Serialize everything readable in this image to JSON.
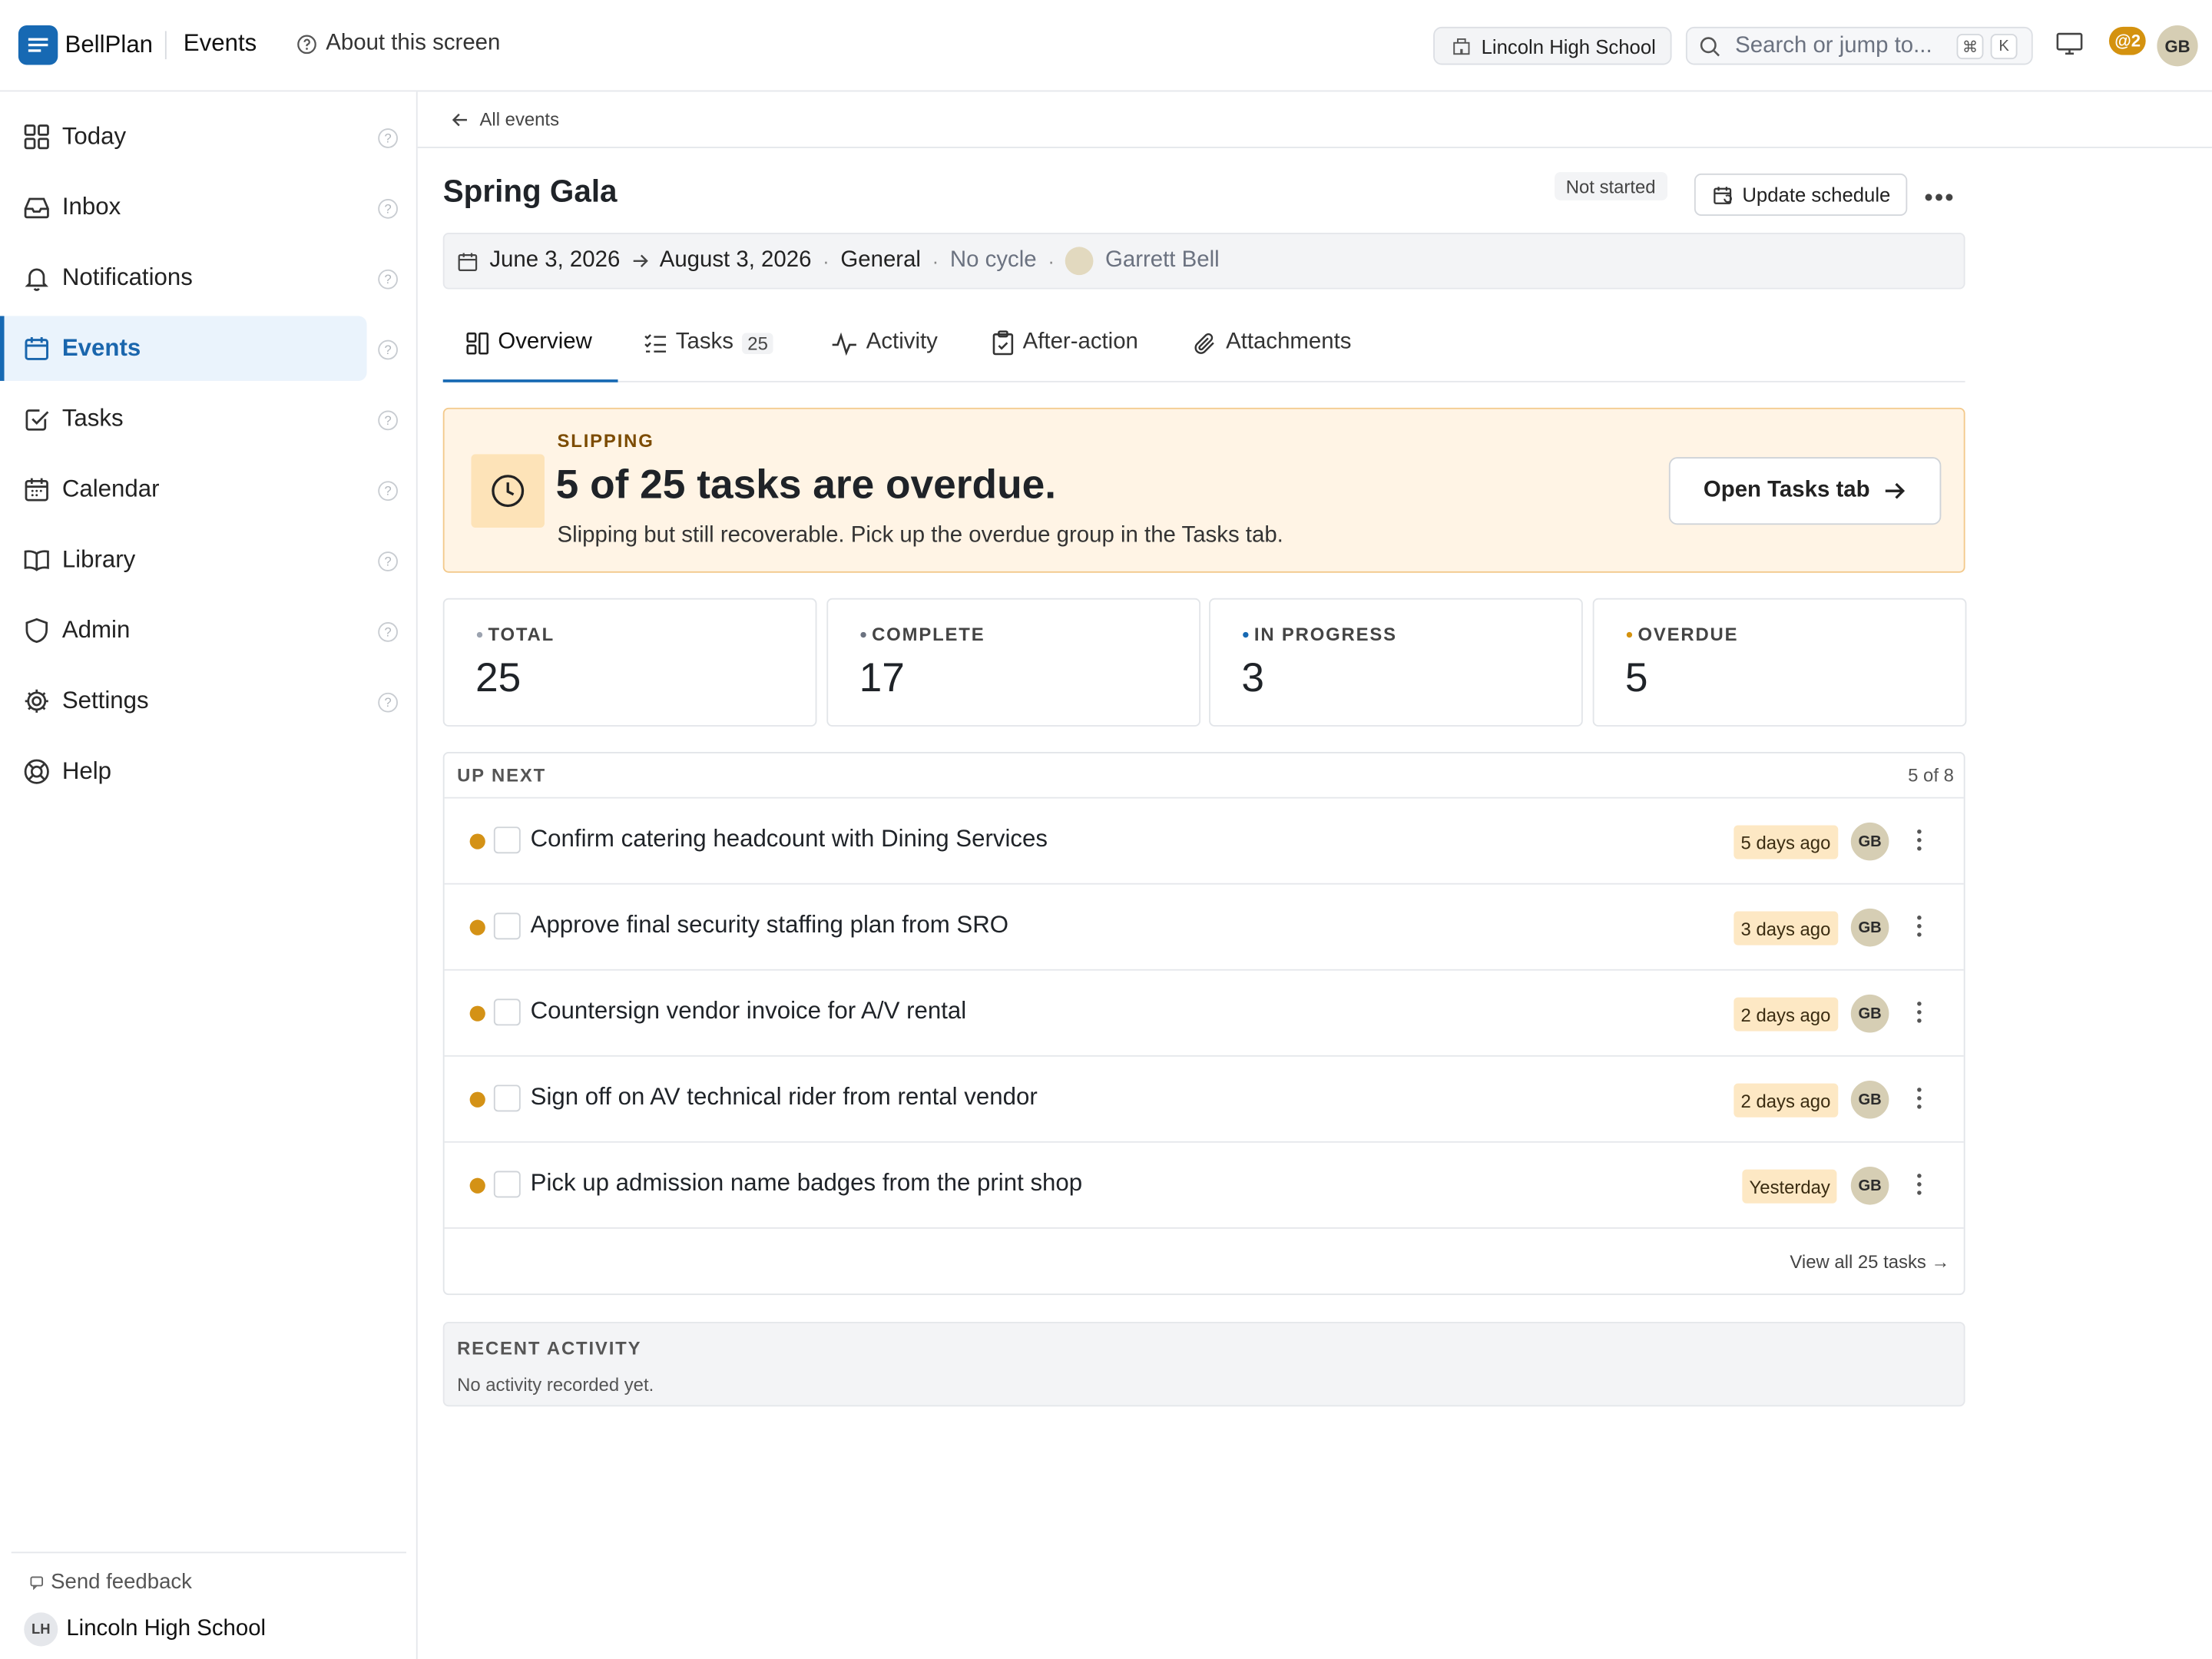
{
  "app": {
    "name": "BellPlan",
    "section": "Events",
    "about": "About this screen"
  },
  "topbar": {
    "school": "Lincoln High School",
    "search_placeholder": "Search or jump to...",
    "kbd_cmd": "⌘",
    "kbd_k": "K",
    "mentions": "@2",
    "user_initials": "GB"
  },
  "sidebar": {
    "items": [
      {
        "label": "Today",
        "icon": "grid-icon"
      },
      {
        "label": "Inbox",
        "icon": "inbox-icon"
      },
      {
        "label": "Notifications",
        "icon": "bell-icon"
      },
      {
        "label": "Events",
        "icon": "calendar-icon",
        "active": true
      },
      {
        "label": "Tasks",
        "icon": "checkbox-icon"
      },
      {
        "label": "Calendar",
        "icon": "calendar-grid-icon"
      },
      {
        "label": "Library",
        "icon": "book-icon"
      },
      {
        "label": "Admin",
        "icon": "shield-icon"
      },
      {
        "label": "Settings",
        "icon": "gear-icon"
      },
      {
        "label": "Help",
        "icon": "lifebuoy-icon"
      }
    ],
    "feedback": "Send feedback",
    "footer_initials": "LH",
    "footer_school": "Lincoln High School"
  },
  "event": {
    "back": "All events",
    "title": "Spring Gala",
    "status": "Not started",
    "update_button": "Update schedule",
    "start": "June 3, 2026",
    "end": "August 3, 2026",
    "category": "General",
    "cycle": "No cycle",
    "owner": "Garrett Bell"
  },
  "tabs": [
    {
      "label": "Overview",
      "active": true
    },
    {
      "label": "Tasks",
      "count": "25"
    },
    {
      "label": "Activity"
    },
    {
      "label": "After-action"
    },
    {
      "label": "Attachments"
    }
  ],
  "alert": {
    "kicker": "SLIPPING",
    "headline": "5 of 25 tasks are overdue.",
    "sub": "Slipping but still recoverable. Pick up the overdue group in the Tasks tab.",
    "button": "Open Tasks tab"
  },
  "stats": [
    {
      "label": "TOTAL",
      "value": "25",
      "dot": "#9ca3af"
    },
    {
      "label": "COMPLETE",
      "value": "17",
      "dot": "#6b7280"
    },
    {
      "label": "IN PROGRESS",
      "value": "3",
      "dot": "#1769b3"
    },
    {
      "label": "OVERDUE",
      "value": "5",
      "dot": "#d4920f"
    }
  ],
  "upnext": {
    "label": "UP NEXT",
    "count": "5 of 8",
    "tasks": [
      {
        "title": "Confirm catering headcount with Dining Services",
        "due": "5 days ago",
        "assignee": "GB"
      },
      {
        "title": "Approve final security staffing plan from SRO",
        "due": "3 days ago",
        "assignee": "GB"
      },
      {
        "title": "Countersign vendor invoice for A/V rental",
        "due": "2 days ago",
        "assignee": "GB"
      },
      {
        "title": "Sign off on AV technical rider from rental vendor",
        "due": "2 days ago",
        "assignee": "GB"
      },
      {
        "title": "Pick up admission name badges from the print shop",
        "due": "Yesterday",
        "assignee": "GB"
      }
    ],
    "view_all": "View all 25 tasks"
  },
  "activity": {
    "label": "RECENT ACTIVITY",
    "empty": "No activity recorded yet."
  },
  "colors": {
    "accent": "#1769b3",
    "warning": "#d4920f",
    "alert_bg": "#fff4e5"
  }
}
